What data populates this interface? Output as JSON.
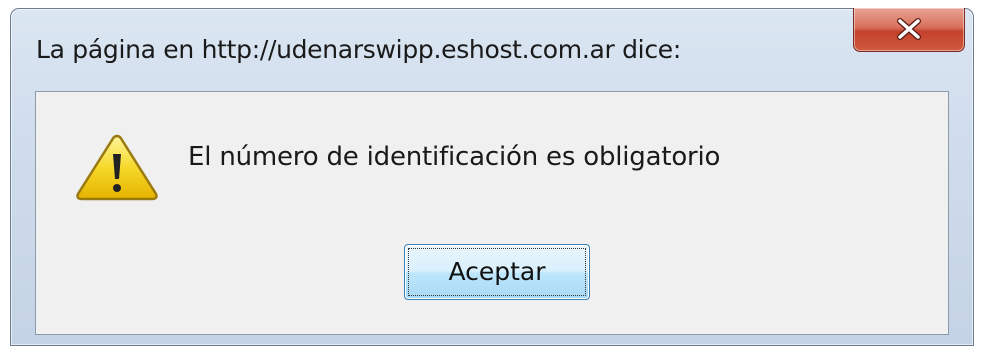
{
  "dialog": {
    "title": "La página en http://udenarswipp.eshost.com.ar dice:",
    "message": "El número de identificación es obligatorio",
    "ok_label": "Aceptar",
    "icon": "warning-icon",
    "close_icon": "close-icon"
  },
  "colors": {
    "close_button": "#c94a33",
    "ok_button_border": "#3c7fb1",
    "warning_fill": "#f5d21c"
  }
}
